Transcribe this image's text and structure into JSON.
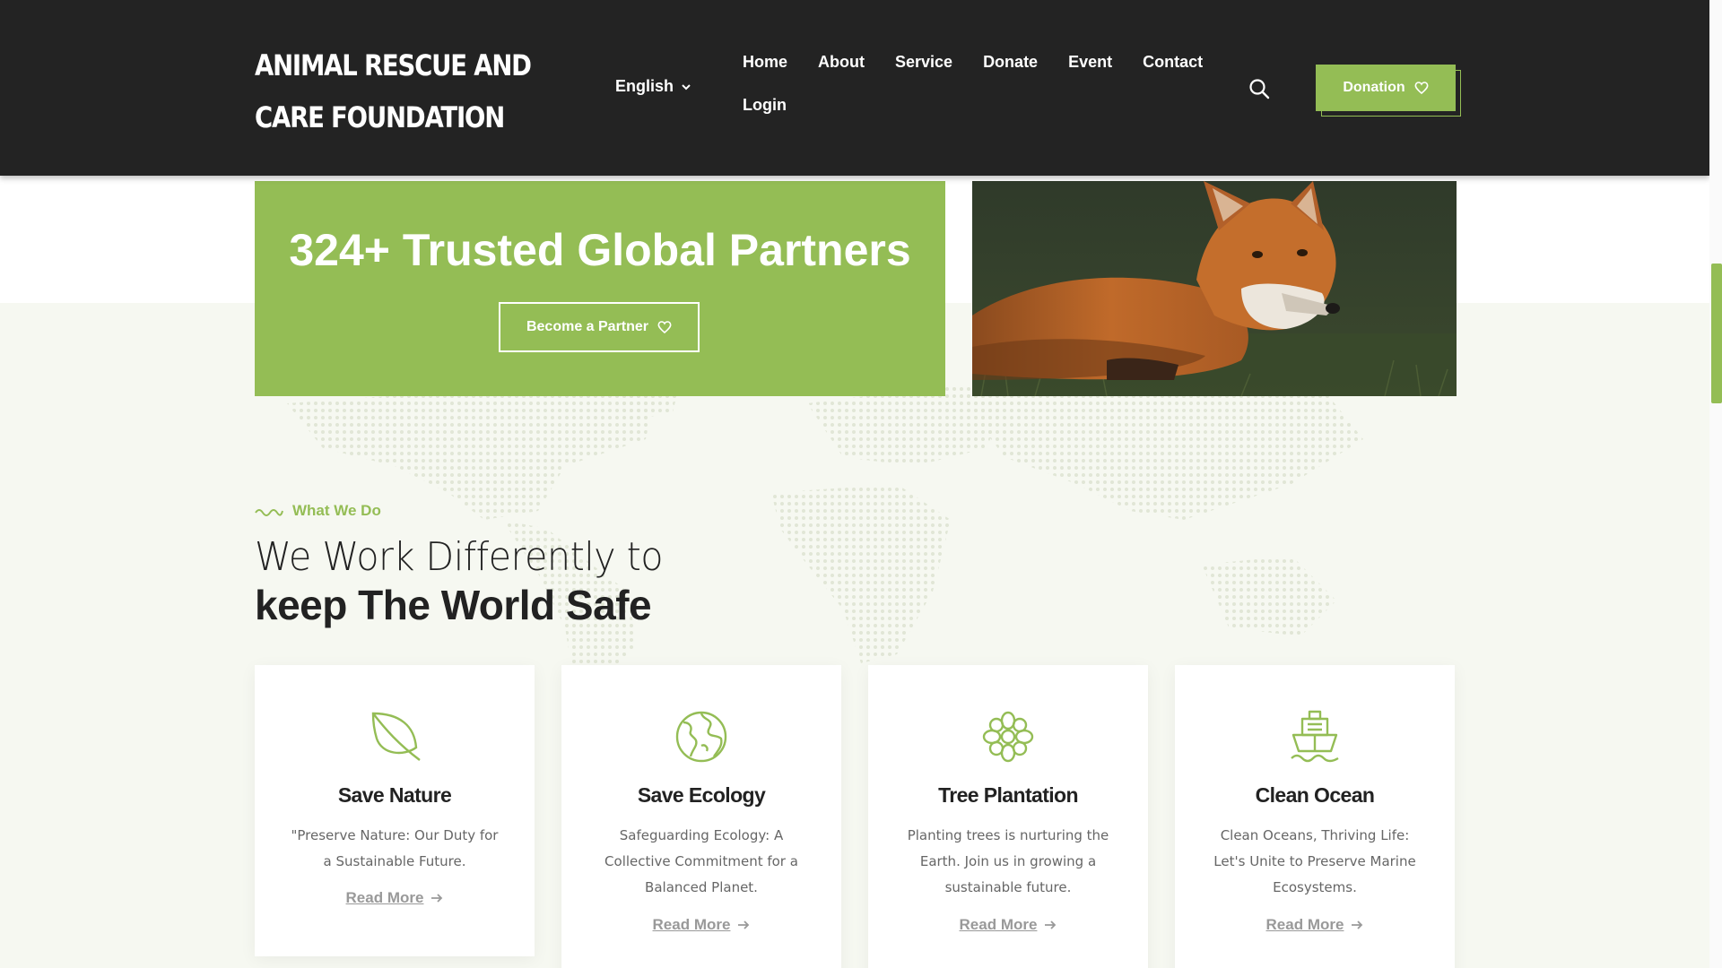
{
  "header": {
    "logo": "ANIMAL RESCUE AND CARE FOUNDATION",
    "language": "English",
    "nav": [
      "Home",
      "About",
      "Service",
      "Donate",
      "Event",
      "Contact",
      "Login"
    ],
    "donate_label": "Donation"
  },
  "partner": {
    "title": "324+ Trusted Global Partners",
    "button_label": "Become a Partner"
  },
  "section": {
    "eyebrow": "What We Do",
    "heading_light": "We Work Differently to",
    "heading_bold": "keep The World Safe"
  },
  "cards": [
    {
      "title": "Save Nature",
      "text": "\"Preserve Nature: Our Duty for a Sustainable Future.",
      "link": "Read More",
      "icon": "leaf-icon"
    },
    {
      "title": "Save Ecology",
      "text": "Safeguarding Ecology: A Collective Commitment for a Balanced Planet.",
      "link": "Read More",
      "icon": "globe-icon"
    },
    {
      "title": "Tree Plantation",
      "text": "Planting trees is nurturing the Earth. Join us in growing a sustainable future.",
      "link": "Read More",
      "icon": "flower-icon"
    },
    {
      "title": "Clean Ocean",
      "text": "Clean Oceans, Thriving Life: Let's Unite to Preserve Marine Ecosystems.",
      "link": "Read More",
      "icon": "ship-icon"
    }
  ],
  "colors": {
    "accent": "#94bd55",
    "header_bg": "#232323",
    "page_bg": "#f6f8f1"
  }
}
